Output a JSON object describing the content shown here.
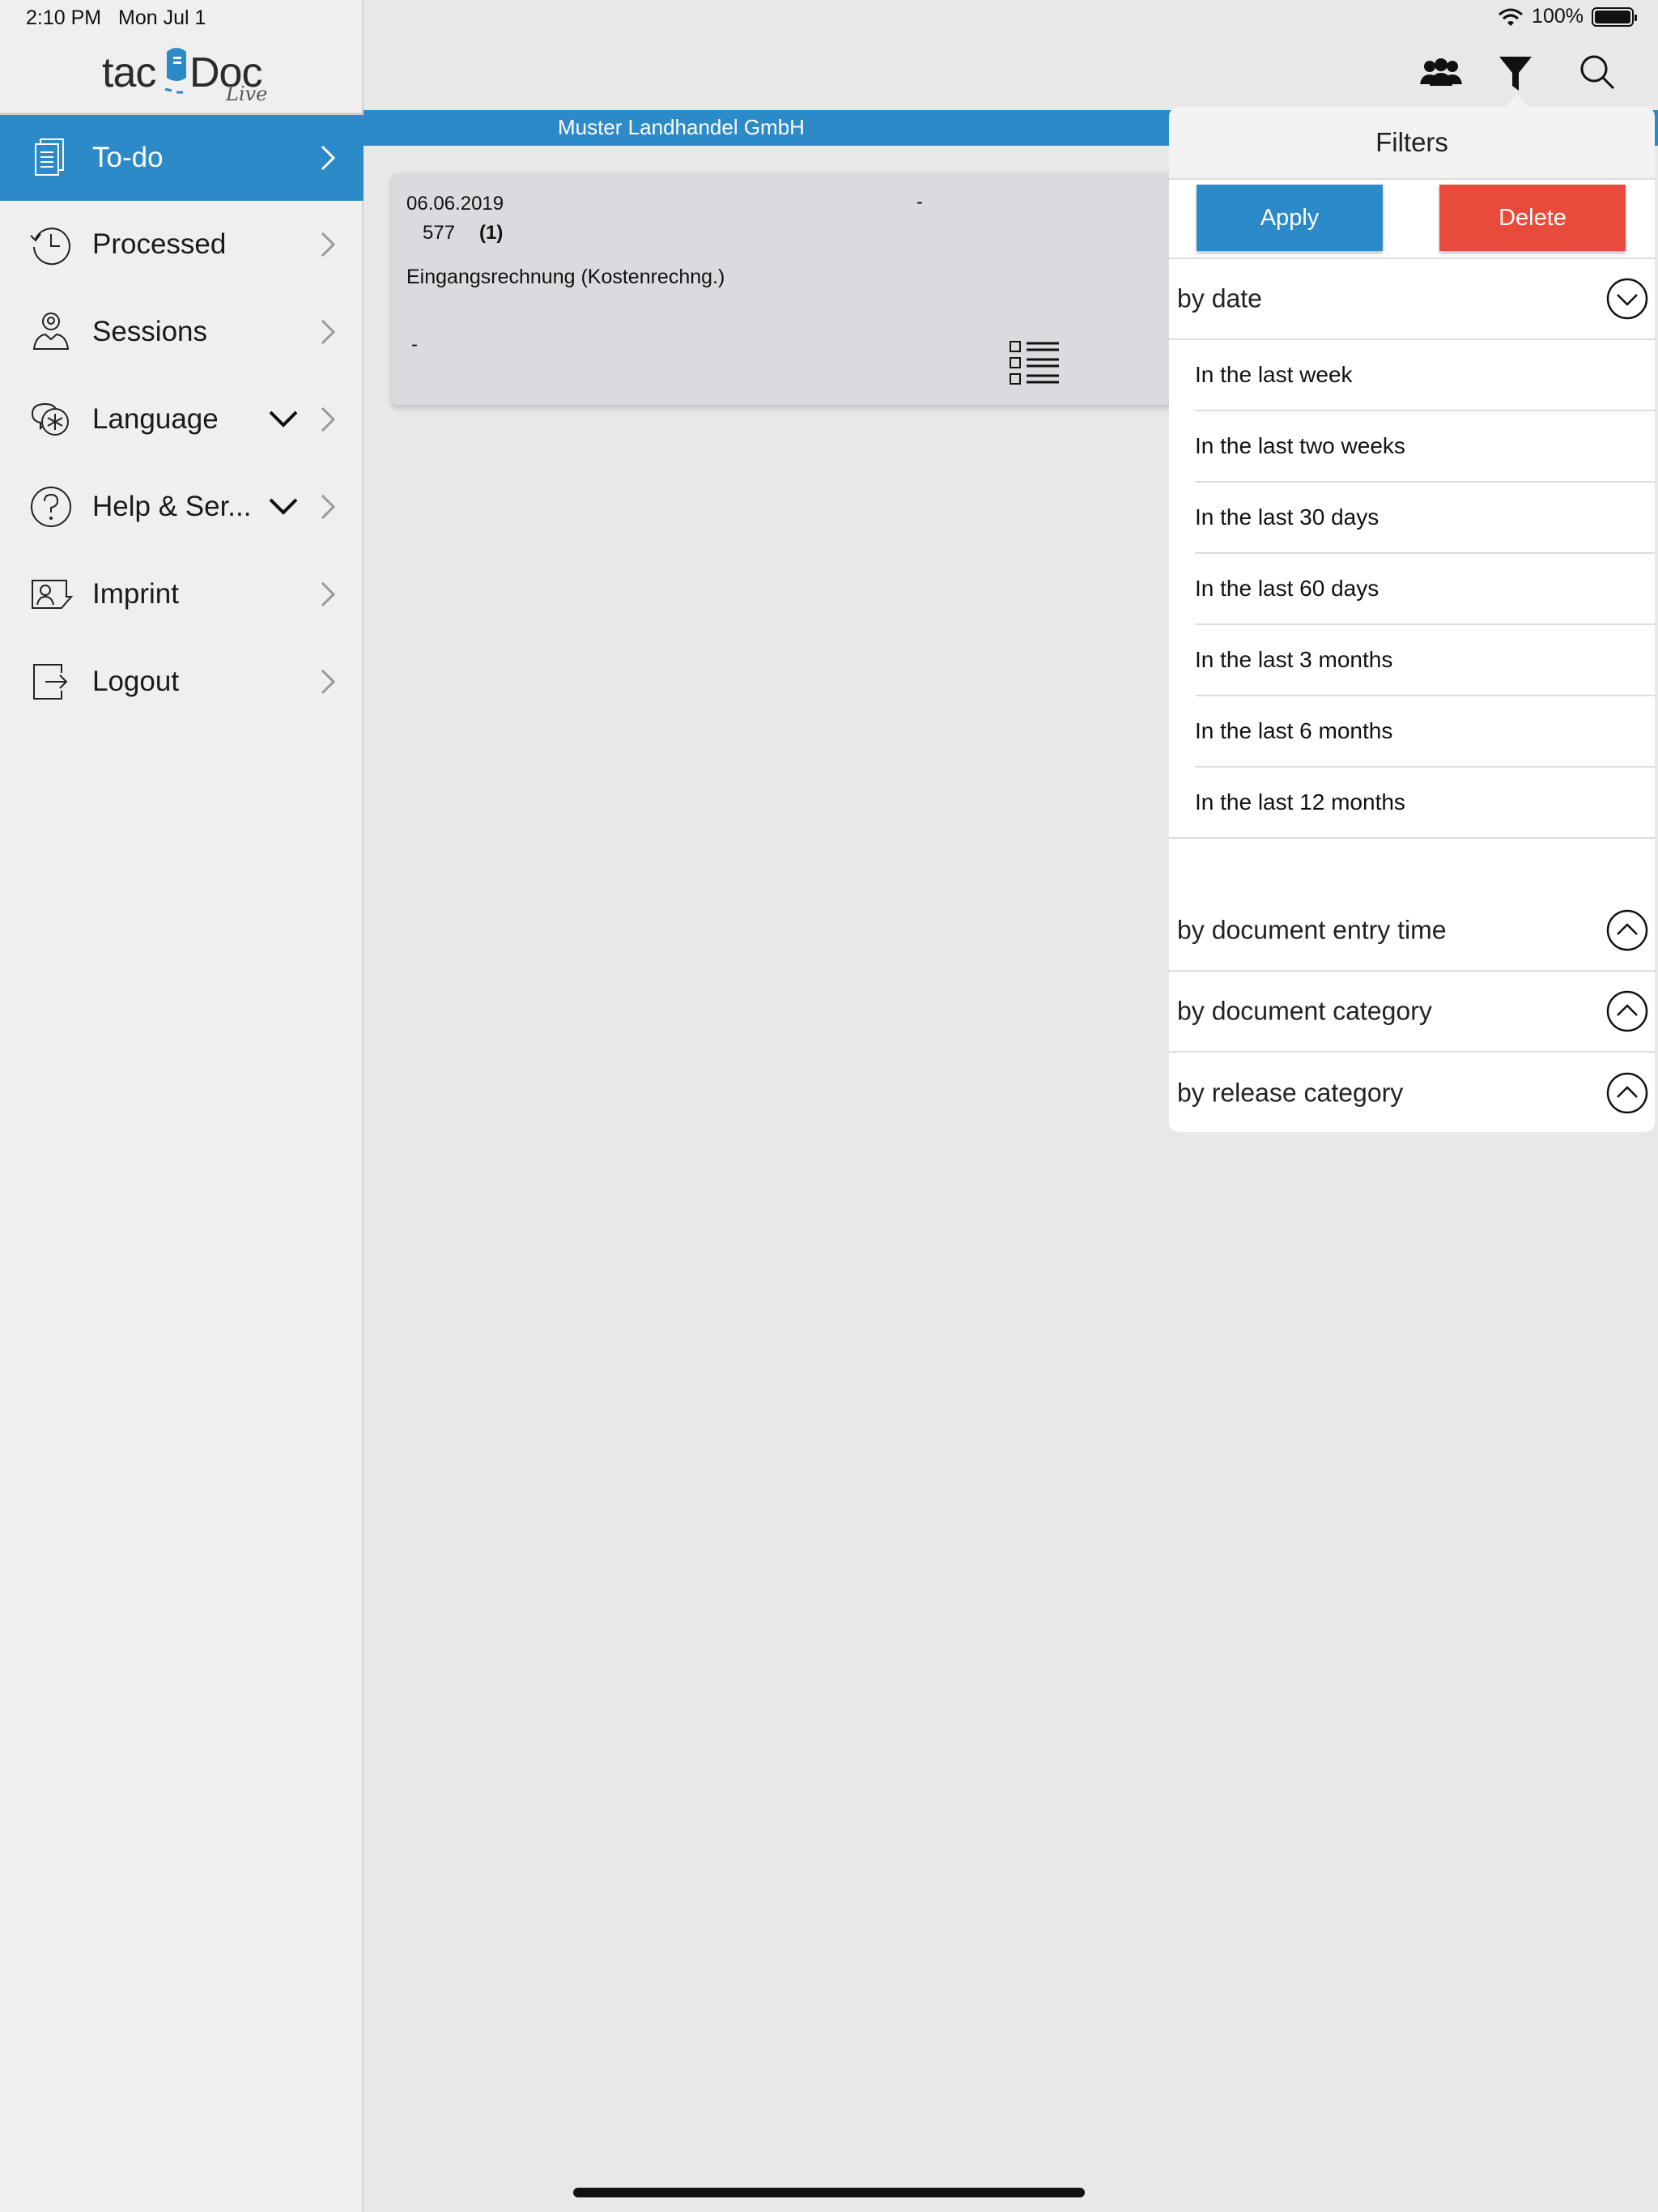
{
  "status": {
    "time": "2:10 PM",
    "date": "Mon Jul 1",
    "battery": "100%"
  },
  "brand": {
    "part1": "tac",
    "part2": "Doc",
    "sub": "Live"
  },
  "sidebar": {
    "items": [
      {
        "label": "To-do",
        "icon": "documents-icon",
        "active": true
      },
      {
        "label": "Processed",
        "icon": "history-icon",
        "active": false
      },
      {
        "label": "Sessions",
        "icon": "user-session-icon",
        "active": false
      },
      {
        "label": "Language",
        "icon": "language-icon",
        "active": false,
        "expand": true
      },
      {
        "label": "Help & Ser...",
        "icon": "help-icon",
        "active": false,
        "expand": true
      },
      {
        "label": "Imprint",
        "icon": "imprint-icon",
        "active": false
      },
      {
        "label": "Logout",
        "icon": "logout-icon",
        "active": false
      }
    ]
  },
  "toolbar": {
    "icons": [
      "group-icon",
      "filter-icon",
      "search-icon"
    ]
  },
  "company": {
    "name": "Muster Landhandel GmbH"
  },
  "document": {
    "date": "06.06.2019",
    "dash1": "-",
    "number": "577",
    "count": "(1)",
    "type": "Eingangsrechnung (Kostenrechng.)",
    "dash2": "-"
  },
  "filters": {
    "title": "Filters",
    "apply_label": "Apply",
    "delete_label": "Delete",
    "by_date": "by date",
    "date_options": [
      "In the last week",
      "In the last two weeks",
      "In the last 30 days",
      "In the last 60 days",
      "In the last 3 months",
      "In the last 6 months",
      "In the last 12 months"
    ],
    "by_entry_time": "by document entry time",
    "by_category": "by document category",
    "by_release": "by release category"
  },
  "colors": {
    "accent": "#2d8ac9",
    "danger": "#e84b3c"
  }
}
